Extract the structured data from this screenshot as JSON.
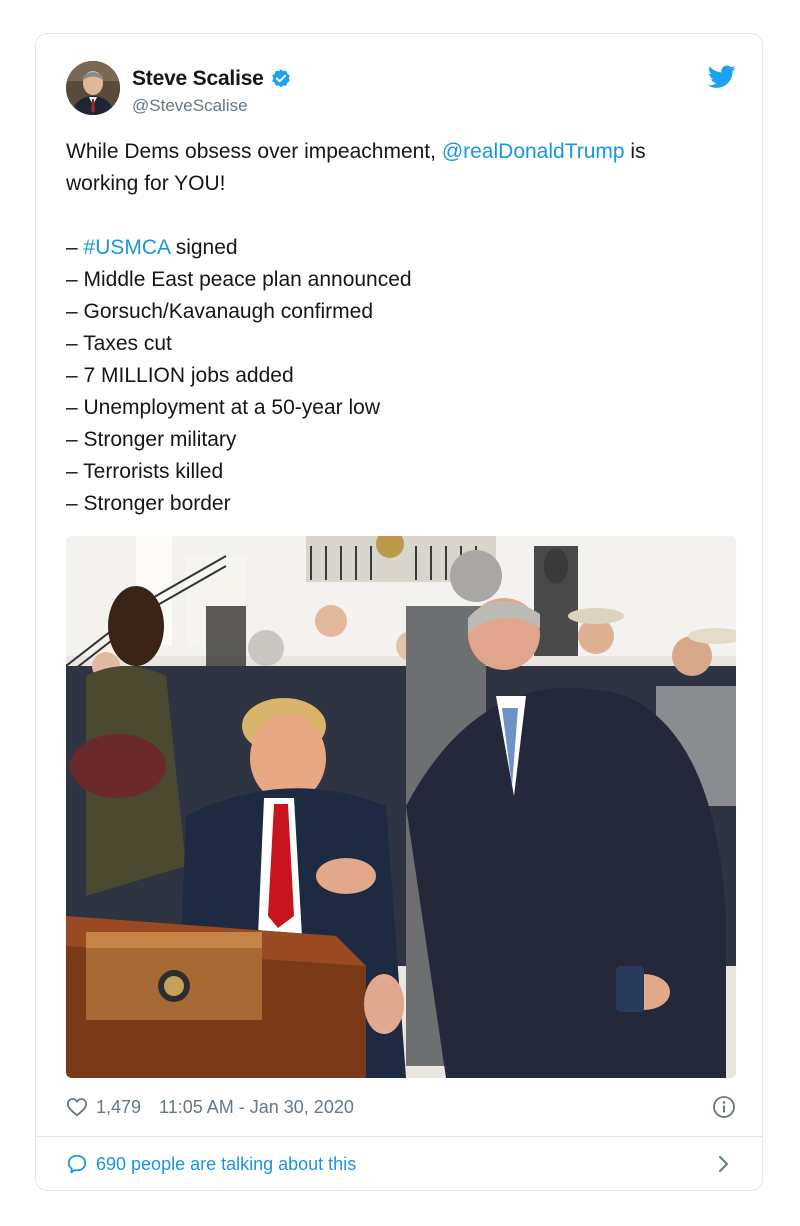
{
  "author": {
    "display_name": "Steve Scalise",
    "handle": "@SteveScalise"
  },
  "icons": {
    "verified": "verified-badge-icon",
    "twitter": "twitter-bird-icon",
    "like": "heart-icon",
    "info": "info-icon",
    "reply": "speech-bubble-icon",
    "chevron": "chevron-right-icon"
  },
  "tweet": {
    "intro_1": "While Dems obsess over impeachment, ",
    "mention": "@realDonaldTrump",
    "intro_2": " is",
    "intro_3": "working for YOU!",
    "list_1_dash": "– ",
    "hashtag": "#USMCA",
    "list_1_rest": " signed",
    "list": [
      "– Middle East peace plan announced",
      "– Gorsuch/Kavanaugh confirmed",
      "– Taxes cut",
      "– 7 MILLION jobs added",
      "– Unemployment at a 50-year low",
      "– Stronger military",
      "– Terrorists killed",
      "– Stronger border"
    ]
  },
  "stats": {
    "likes": "1,479",
    "timestamp": "11:05 AM - Jan 30, 2020"
  },
  "footer": {
    "conversation": "690 people are talking about this"
  },
  "colors": {
    "link": "#1b95e0",
    "text": "#14171a",
    "muted": "#657786",
    "border": "#e1e8ed"
  }
}
